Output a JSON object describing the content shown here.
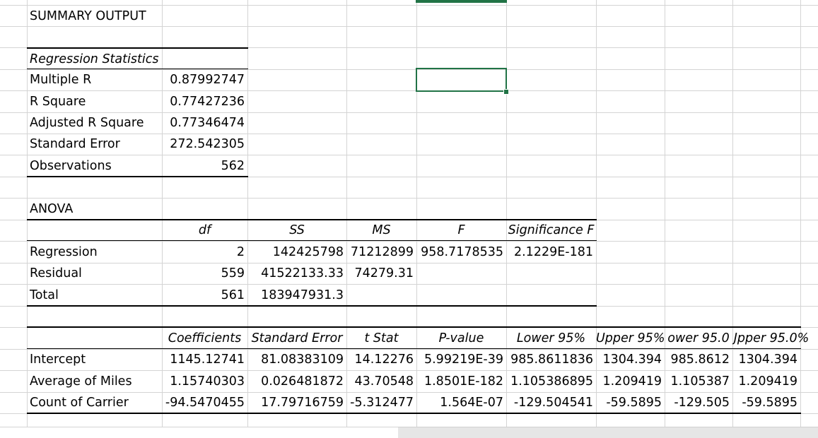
{
  "sheet": {
    "summary_title": "SUMMARY OUTPUT",
    "regression_statistics": {
      "header": "Regression Statistics",
      "rows": [
        {
          "label": "Multiple R",
          "value": "0.87992747"
        },
        {
          "label": "R Square",
          "value": "0.77427236"
        },
        {
          "label": "Adjusted R Square",
          "value": "0.77346474"
        },
        {
          "label": "Standard Error",
          "value": "272.542305"
        },
        {
          "label": "Observations",
          "value": "562"
        }
      ]
    },
    "anova": {
      "title": "ANOVA",
      "headers": [
        "df",
        "SS",
        "MS",
        "F",
        "Significance F"
      ],
      "rows": [
        {
          "label": "Regression",
          "cells": [
            "2",
            "142425798",
            "71212899",
            "958.7178535",
            "2.1229E-181"
          ]
        },
        {
          "label": "Residual",
          "cells": [
            "559",
            "41522133.33",
            "74279.31",
            "",
            ""
          ]
        },
        {
          "label": "Total",
          "cells": [
            "561",
            "183947931.3",
            "",
            "",
            ""
          ]
        }
      ]
    },
    "coefficients": {
      "headers": [
        "Coefficients",
        "Standard Error",
        "t Stat",
        "P-value",
        "Lower 95%",
        "Upper 95%",
        "ower 95.0",
        "Jpper 95.0%"
      ],
      "rows": [
        {
          "label": "Intercept",
          "cells": [
            "1145.12741",
            "81.08383109",
            "14.12276",
            "5.99219E-39",
            "985.8611836",
            "1304.394",
            "985.8612",
            "1304.394"
          ]
        },
        {
          "label": "Average of Miles",
          "cells": [
            "1.15740303",
            "0.026481872",
            "43.70548",
            "1.8501E-182",
            "1.105386895",
            "1.209419",
            "1.105387",
            "1.209419"
          ]
        },
        {
          "label": "Count of Carrier",
          "cells": [
            "-94.5470455",
            "17.79716759",
            "-5.312477",
            "1.564E-07",
            "-129.504541",
            "-59.5895",
            "-129.505",
            "-59.5895"
          ]
        }
      ]
    }
  },
  "colors": {
    "gridline": "#d4d4d4",
    "selection": "#217346"
  }
}
